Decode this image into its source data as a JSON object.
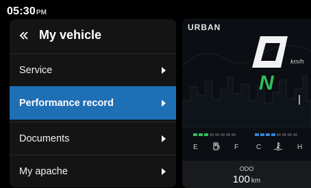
{
  "status": {
    "time": "05:30",
    "ampm": "PM"
  },
  "menu": {
    "title": "My vehicle",
    "items": [
      {
        "label": "Service",
        "active": false
      },
      {
        "label": "Performance record",
        "active": true
      },
      {
        "label": "Documents",
        "active": false
      },
      {
        "label": "My apache",
        "active": false
      }
    ]
  },
  "dashboard": {
    "mode": "URBAN",
    "speed": "0",
    "speed_unit": "km/h",
    "gear": "N",
    "fuel_labels": {
      "empty": "E",
      "full": "F"
    },
    "temp_labels": {
      "cold": "C",
      "hot": "H"
    },
    "fuel_level_segments": 3,
    "temp_level_segments": 4,
    "total_segments": 8,
    "odo": {
      "title": "ODO",
      "value": "100",
      "unit": "km"
    }
  },
  "colors": {
    "accent": "#1f6fb5",
    "gear": "#2fbf5a",
    "fuel_on": "#2fbf5a",
    "temp_on": "#2f86d6",
    "segment_off": "#3a3d42"
  },
  "icons": {
    "back": "double-chevron-left-icon",
    "chevron": "chevron-right-icon",
    "fuel": "fuel-pump-icon",
    "temperature": "coolant-temperature-icon"
  }
}
